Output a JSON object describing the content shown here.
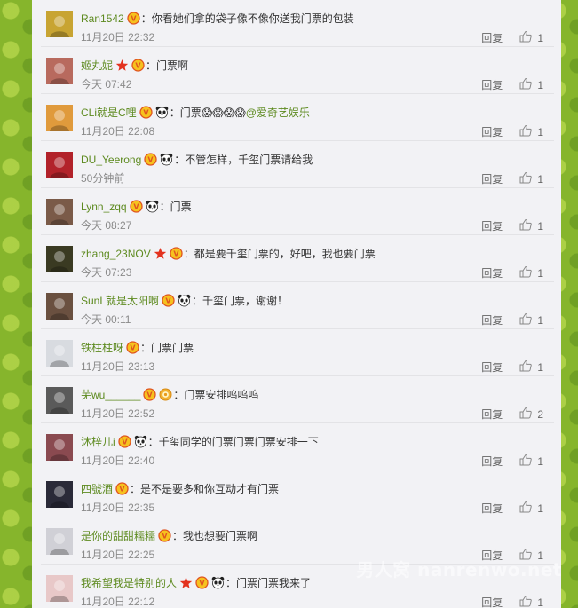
{
  "reply_label": "回复",
  "colors": {
    "name": "#5d8a1f",
    "page_bg": "#86b52c",
    "panel_bg": "#f2f2f5"
  },
  "watermark": "男人窝 nanrenwo.net",
  "comments": [
    {
      "name": "Ran1542",
      "badges": [
        "vip-icon"
      ],
      "text": "你看她们拿的袋子像不像你送我门票的包装",
      "mention": "",
      "time": "11月20日 22:32",
      "likes": "1",
      "avatar": "#c8a432"
    },
    {
      "name": "姬丸妮",
      "badges": [
        "star-icon",
        "vip-icon"
      ],
      "text": "门票啊",
      "mention": "",
      "time": "今天 07:42",
      "likes": "1",
      "avatar": "#b86a5e"
    },
    {
      "name": "CLi就是C哩",
      "badges": [
        "vip-icon",
        "panda-icon"
      ],
      "text": "门票😱😱😱😱",
      "mention": "@爱奇艺娱乐",
      "time": "11月20日 22:08",
      "likes": "1",
      "avatar": "#e09a3c"
    },
    {
      "name": "DU_Yeerong",
      "badges": [
        "vip-icon",
        "panda-icon"
      ],
      "text": "不管怎样，千玺门票请给我",
      "mention": "",
      "time": "50分钟前",
      "likes": "1",
      "avatar": "#b2222a"
    },
    {
      "name": "Lynn_zqq",
      "badges": [
        "vip-icon",
        "panda-icon"
      ],
      "text": "门票",
      "mention": "",
      "time": "今天 08:27",
      "likes": "1",
      "avatar": "#7a5a48"
    },
    {
      "name": "zhang_23NOV",
      "badges": [
        "star-icon",
        "vip-icon"
      ],
      "text": "都是要千玺门票的，好吧，我也要门票",
      "mention": "",
      "time": "今天 07:23",
      "likes": "1",
      "avatar": "#3a3a22"
    },
    {
      "name": "SunL就是太阳啊",
      "badges": [
        "vip-icon",
        "panda-icon"
      ],
      "text": "千玺门票，谢谢！",
      "mention": "",
      "time": "今天 00:11",
      "likes": "1",
      "avatar": "#6a5040"
    },
    {
      "name": "铁柱柱呀",
      "badges": [
        "vip-icon"
      ],
      "text": "门票门票",
      "mention": "",
      "time": "11月20日 23:13",
      "likes": "1",
      "avatar": "#d8dbe0"
    },
    {
      "name": "芜wu______",
      "badges": [
        "vip-icon",
        "medal-icon"
      ],
      "text": "门票安排呜呜呜",
      "mention": "",
      "time": "11月20日 22:52",
      "likes": "2",
      "avatar": "#5a5a5a"
    },
    {
      "name": "沐梓儿i",
      "badges": [
        "vip-icon",
        "panda-icon"
      ],
      "text": "千玺同学的门票门票门票安排一下",
      "mention": "",
      "time": "11月20日 22:40",
      "likes": "1",
      "avatar": "#8a4a50"
    },
    {
      "name": "四號酒",
      "badges": [
        "vip-icon"
      ],
      "text": "是不是要多和你互动才有门票",
      "mention": "",
      "time": "11月20日 22:35",
      "likes": "1",
      "avatar": "#2a2a38"
    },
    {
      "name": "是你的甜甜糯糯",
      "badges": [
        "vip-icon"
      ],
      "text": "我也想要门票啊",
      "mention": "",
      "time": "11月20日 22:25",
      "likes": "1",
      "avatar": "#d0d0d6"
    },
    {
      "name": "我希望我是特别的人",
      "badges": [
        "star-icon",
        "vip-icon",
        "panda-icon"
      ],
      "text": "门票门票我来了",
      "mention": "",
      "time": "11月20日 22:12",
      "likes": "1",
      "avatar": "#e8c8c8"
    }
  ]
}
